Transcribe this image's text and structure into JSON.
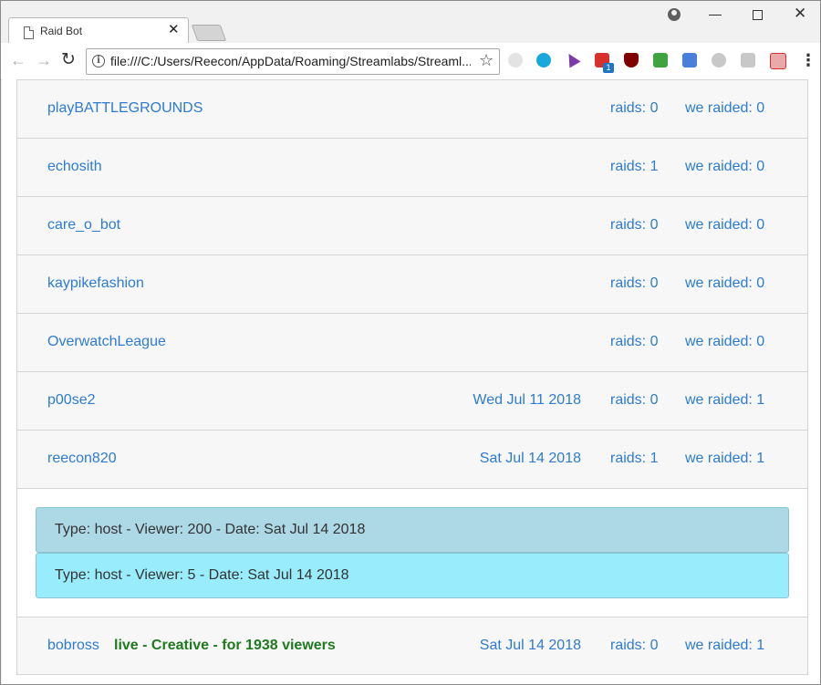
{
  "browser": {
    "tab_title": "Raid Bot",
    "tab_close": "✕",
    "url": "file:///C:/Users/Reecon/AppData/Roaming/Streamlabs/Streaml...",
    "ext_badge": "1"
  },
  "rows": [
    {
      "name": "playBATTLEGROUNDS",
      "date": "",
      "raids": "raids: 0",
      "we_raided": "we raided: 0"
    },
    {
      "name": "echosith",
      "date": "",
      "raids": "raids: 1",
      "we_raided": "we raided: 0"
    },
    {
      "name": "care_o_bot",
      "date": "",
      "raids": "raids: 0",
      "we_raided": "we raided: 0"
    },
    {
      "name": "kaypikefashion",
      "date": "",
      "raids": "raids: 0",
      "we_raided": "we raided: 0"
    },
    {
      "name": "OverwatchLeague",
      "date": "",
      "raids": "raids: 0",
      "we_raided": "we raided: 0"
    },
    {
      "name": "p00se2",
      "date": "Wed Jul 11 2018",
      "raids": "raids: 0",
      "we_raided": "we raided: 1"
    },
    {
      "name": "reecon820",
      "date": "Sat Jul 14 2018",
      "raids": "raids: 1",
      "we_raided": "we raided: 1"
    }
  ],
  "details": [
    "Type: host - Viewer: 200 - Date: Sat Jul 14 2018",
    "Type: host - Viewer: 5 - Date: Sat Jul 14 2018"
  ],
  "last_row": {
    "name": "bobross",
    "live": "live - Creative - for 1938 viewers",
    "date": "Sat Jul 14 2018",
    "raids": "raids: 0",
    "we_raided": "we raided: 1"
  },
  "colors": {
    "link": "#2e7bd1",
    "live": "#1f7a1f",
    "detail_host_1": "#add8e6",
    "detail_host_2": "#98ecfb"
  }
}
